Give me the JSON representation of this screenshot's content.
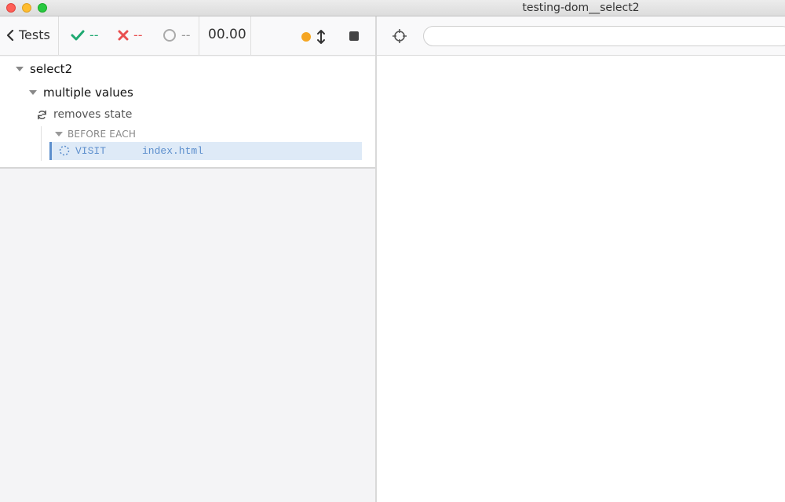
{
  "window": {
    "title": "testing-dom__select2"
  },
  "toolbar": {
    "tests_label": "Tests",
    "passed": "--",
    "failed": "--",
    "pending": "--",
    "duration": "00.00"
  },
  "runnables": {
    "suite": "select2",
    "nested_suite": "multiple values",
    "test": "removes state",
    "hook": "BEFORE EACH",
    "command": {
      "name": "VISIT",
      "message": "index.html"
    }
  },
  "aut": {
    "url": ""
  },
  "colors": {
    "passed": "#1fa971",
    "failed": "#e94f4f",
    "running": "#f5a623",
    "command": "#5d8fcd"
  },
  "icons": {
    "back": "chevron-left-icon",
    "passed": "check-icon",
    "failed": "x-icon",
    "pending": "circle-outline-icon",
    "auto_scroll": "arrows-vertical-icon",
    "stop": "stop-icon",
    "selector": "crosshair-icon",
    "test_state": "refresh-icon",
    "command_state": "spinner-icon"
  }
}
